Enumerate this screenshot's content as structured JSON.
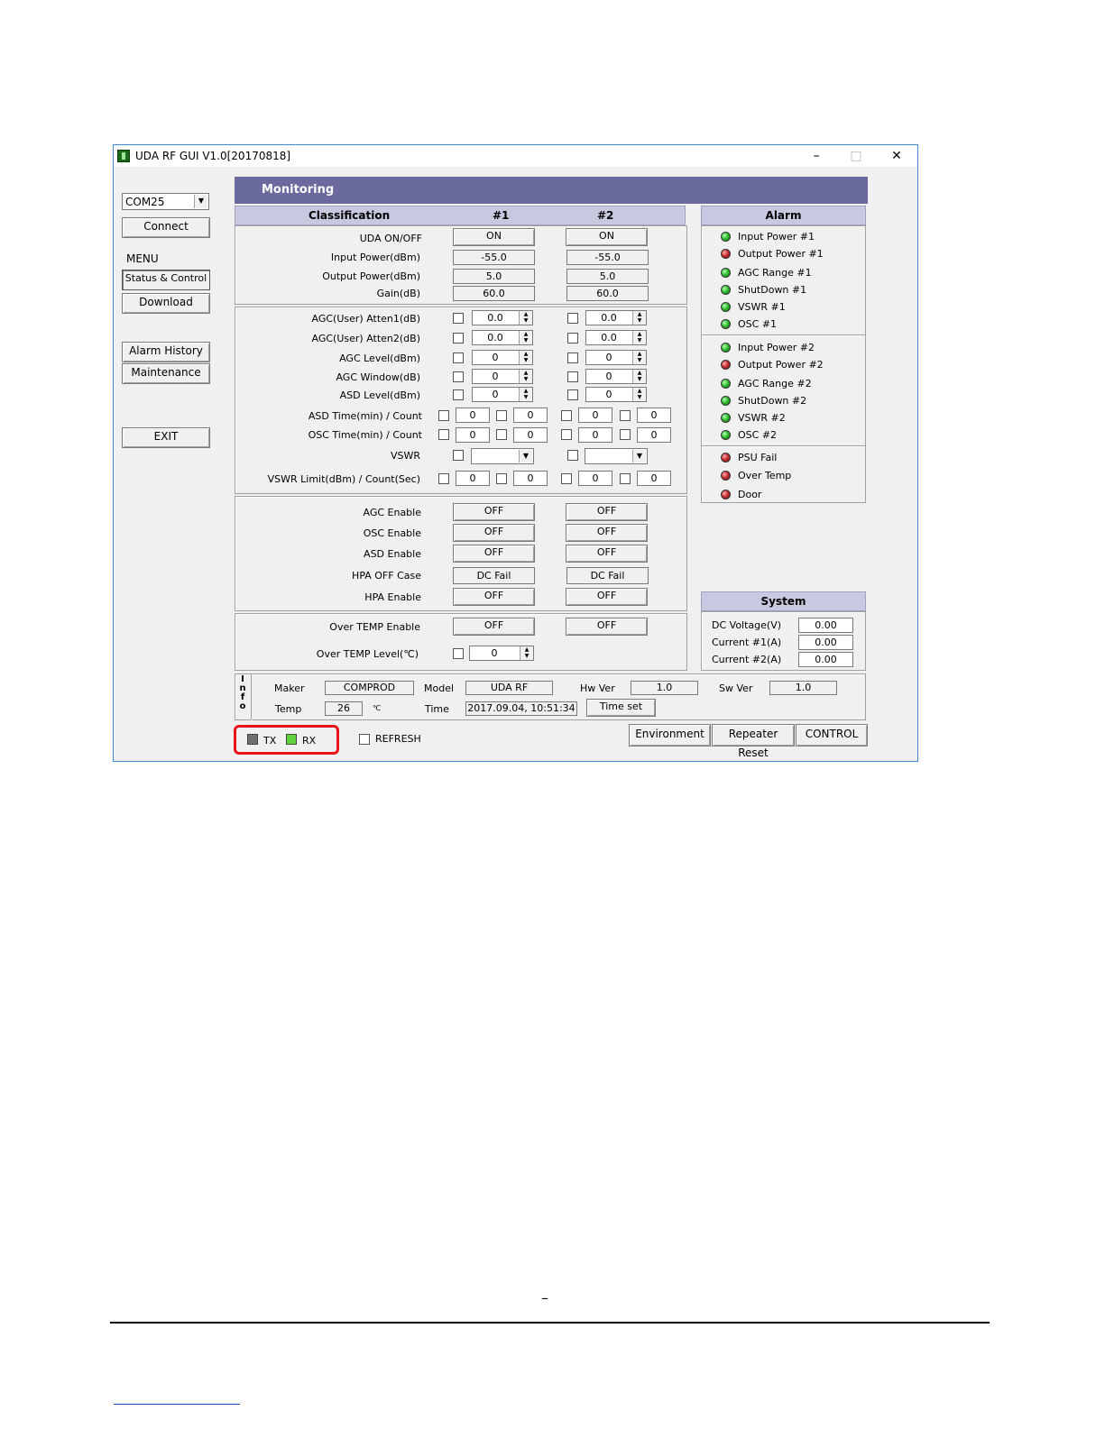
{
  "window": {
    "title": "UDA RF GUI V1.0[20170818]",
    "minimize": "–",
    "maximize": "□",
    "close": "✕"
  },
  "sidebar": {
    "port": "COM25",
    "connect": "Connect",
    "menu_label": "MENU",
    "status_control": "Status & Control",
    "download": "Download",
    "alarm_history": "Alarm History",
    "maintenance": "Maintenance",
    "exit": "EXIT"
  },
  "monitoring": {
    "title": "Monitoring",
    "col_classification": "Classification",
    "col_1": "#1",
    "col_2": "#2"
  },
  "status": {
    "uda_label": "UDA ON/OFF",
    "uda_1": "ON",
    "uda_2": "ON",
    "input_label": "Input Power(dBm)",
    "input_1": "-55.0",
    "input_2": "-55.0",
    "output_label": "Output Power(dBm)",
    "output_1": "5.0",
    "output_2": "5.0",
    "gain_label": "Gain(dB)",
    "gain_1": "60.0",
    "gain_2": "60.0"
  },
  "control": {
    "atten1_label": "AGC(User) Atten1(dB)",
    "atten1_1": "0.0",
    "atten1_2": "0.0",
    "atten2_label": "AGC(User) Atten2(dB)",
    "atten2_1": "0.0",
    "atten2_2": "0.0",
    "agclevel_label": "AGC Level(dBm)",
    "agclevel_1": "0",
    "agclevel_2": "0",
    "agcwindow_label": "AGC Window(dB)",
    "agcwindow_1": "0",
    "agcwindow_2": "0",
    "asdlevel_label": "ASD Level(dBm)",
    "asdlevel_1": "0",
    "asdlevel_2": "0",
    "asdtime_label": "ASD Time(min) / Count",
    "asdtime_1a": "0",
    "asdtime_1b": "0",
    "asdtime_2a": "0",
    "asdtime_2b": "0",
    "osctime_label": "OSC Time(min) / Count",
    "osctime_1a": "0",
    "osctime_1b": "0",
    "osctime_2a": "0",
    "osctime_2b": "0",
    "vswr_label": "VSWR",
    "vswrlimit_label": "VSWR Limit(dBm) / Count(Sec)",
    "vswrlimit_1a": "0",
    "vswrlimit_1b": "0",
    "vswrlimit_2a": "0",
    "vswrlimit_2b": "0"
  },
  "enable": {
    "agc_label": "AGC Enable",
    "agc_1": "OFF",
    "agc_2": "OFF",
    "osc_label": "OSC Enable",
    "osc_1": "OFF",
    "osc_2": "OFF",
    "asd_label": "ASD Enable",
    "asd_1": "OFF",
    "asd_2": "OFF",
    "hpacase_label": "HPA OFF Case",
    "hpacase_1": "DC Fail",
    "hpacase_2": "DC Fail",
    "hpa_label": "HPA Enable",
    "hpa_1": "OFF",
    "hpa_2": "OFF"
  },
  "overtemp": {
    "enable_label": "Over TEMP Enable",
    "enable_1": "OFF",
    "enable_2": "OFF",
    "level_label": "Over TEMP Level(℃)",
    "level_1": "0"
  },
  "alarm": {
    "title": "Alarm",
    "group1": [
      "Input Power #1",
      "Output Power #1",
      "AGC Range #1",
      "ShutDown #1",
      "VSWR #1",
      "OSC #1"
    ],
    "group2": [
      "Input Power #2",
      "Output Power #2",
      "AGC Range #2",
      "ShutDown #2",
      "VSWR #2",
      "OSC #2"
    ],
    "group3": [
      "PSU Fail",
      "Over Temp",
      "Door"
    ]
  },
  "system": {
    "title": "System",
    "dc_label": "DC Voltage(V)",
    "dc_value": "0.00",
    "cur1_label": "Current #1(A)",
    "cur1_value": "0.00",
    "cur2_label": "Current #2(A)",
    "cur2_value": "0.00"
  },
  "info": {
    "tag": "I n f o",
    "maker_label": "Maker",
    "maker_value": "COMPROD",
    "model_label": "Model",
    "model_value": "UDA RF",
    "hw_label": "Hw Ver",
    "hw_value": "1.0",
    "sw_label": "Sw Ver",
    "sw_value": "1.0",
    "temp_label": "Temp",
    "temp_value": "26",
    "temp_unit": "℃",
    "time_label": "Time",
    "time_value": "2017.09.04, 10:51:34",
    "time_set": "Time set"
  },
  "bottom": {
    "tx": "TX",
    "rx": "RX",
    "refresh": "REFRESH",
    "environment": "Environment",
    "repeater_reset": "Repeater Reset",
    "control": "CONTROL"
  },
  "page": {
    "dash": "–"
  }
}
